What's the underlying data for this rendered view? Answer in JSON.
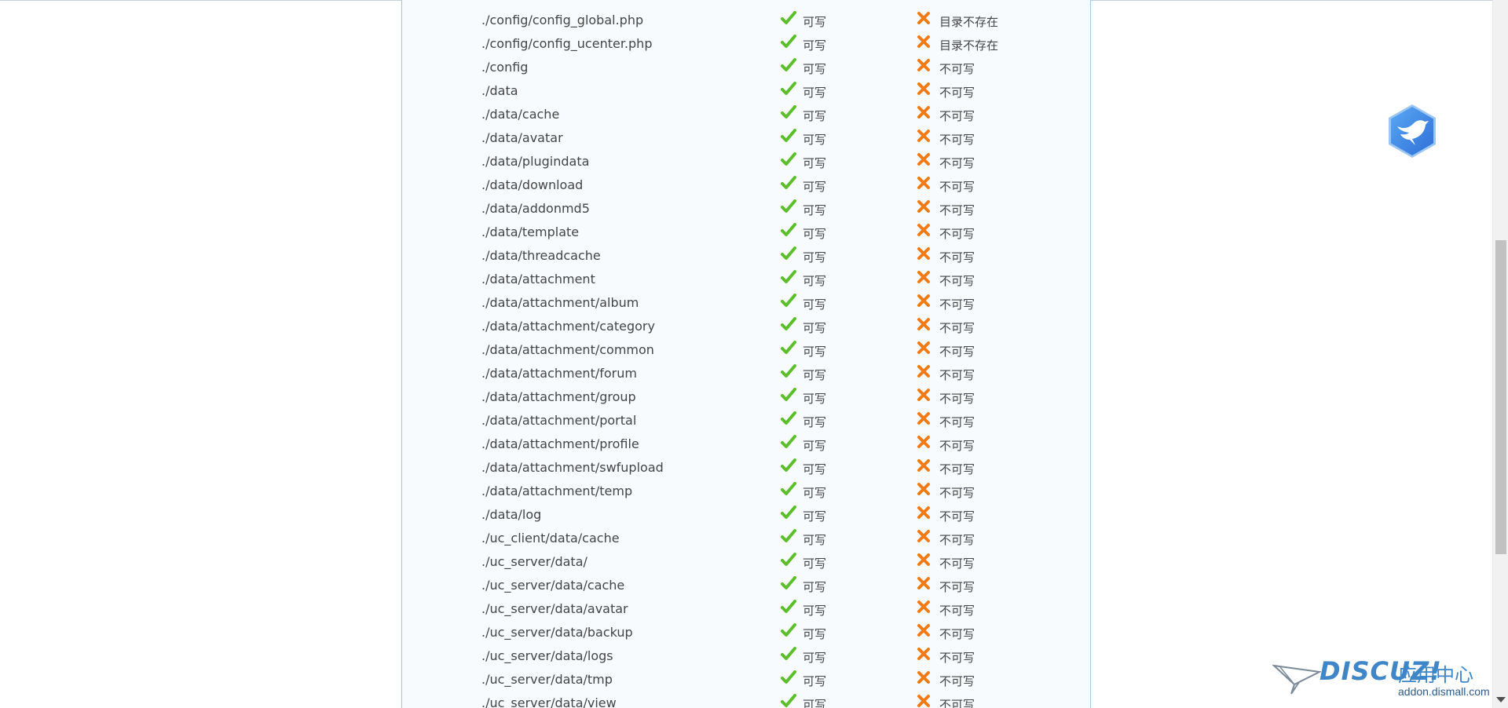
{
  "rows": [
    {
      "path": "./config/config_global.php",
      "current": "可写",
      "required": "目录不存在"
    },
    {
      "path": "./config/config_ucenter.php",
      "current": "可写",
      "required": "目录不存在"
    },
    {
      "path": "./config",
      "current": "可写",
      "required": "不可写"
    },
    {
      "path": "./data",
      "current": "可写",
      "required": "不可写"
    },
    {
      "path": "./data/cache",
      "current": "可写",
      "required": "不可写"
    },
    {
      "path": "./data/avatar",
      "current": "可写",
      "required": "不可写"
    },
    {
      "path": "./data/plugindata",
      "current": "可写",
      "required": "不可写"
    },
    {
      "path": "./data/download",
      "current": "可写",
      "required": "不可写"
    },
    {
      "path": "./data/addonmd5",
      "current": "可写",
      "required": "不可写"
    },
    {
      "path": "./data/template",
      "current": "可写",
      "required": "不可写"
    },
    {
      "path": "./data/threadcache",
      "current": "可写",
      "required": "不可写"
    },
    {
      "path": "./data/attachment",
      "current": "可写",
      "required": "不可写"
    },
    {
      "path": "./data/attachment/album",
      "current": "可写",
      "required": "不可写"
    },
    {
      "path": "./data/attachment/category",
      "current": "可写",
      "required": "不可写"
    },
    {
      "path": "./data/attachment/common",
      "current": "可写",
      "required": "不可写"
    },
    {
      "path": "./data/attachment/forum",
      "current": "可写",
      "required": "不可写"
    },
    {
      "path": "./data/attachment/group",
      "current": "可写",
      "required": "不可写"
    },
    {
      "path": "./data/attachment/portal",
      "current": "可写",
      "required": "不可写"
    },
    {
      "path": "./data/attachment/profile",
      "current": "可写",
      "required": "不可写"
    },
    {
      "path": "./data/attachment/swfupload",
      "current": "可写",
      "required": "不可写"
    },
    {
      "path": "./data/attachment/temp",
      "current": "可写",
      "required": "不可写"
    },
    {
      "path": "./data/log",
      "current": "可写",
      "required": "不可写"
    },
    {
      "path": "./uc_client/data/cache",
      "current": "可写",
      "required": "不可写"
    },
    {
      "path": "./uc_server/data/",
      "current": "可写",
      "required": "不可写"
    },
    {
      "path": "./uc_server/data/cache",
      "current": "可写",
      "required": "不可写"
    },
    {
      "path": "./uc_server/data/avatar",
      "current": "可写",
      "required": "不可写"
    },
    {
      "path": "./uc_server/data/backup",
      "current": "可写",
      "required": "不可写"
    },
    {
      "path": "./uc_server/data/logs",
      "current": "可写",
      "required": "不可写"
    },
    {
      "path": "./uc_server/data/tmp",
      "current": "可写",
      "required": "不可写"
    },
    {
      "path": "./uc_server/data/view",
      "current": "可写",
      "required": "不可写"
    }
  ],
  "icons": {
    "current_status": "check-icon",
    "required_status": "cross-icon",
    "check_color": "#5cbf2a",
    "cross_color": "#f07b15"
  },
  "watermark": {
    "logo": "DISCUZ!",
    "label": "应用中心",
    "url": "addon.dismall.com"
  },
  "colors": {
    "panel_bg": "#f7fbfe",
    "panel_border": "#a7c6dd",
    "badge_blue": "#3a86e8"
  }
}
